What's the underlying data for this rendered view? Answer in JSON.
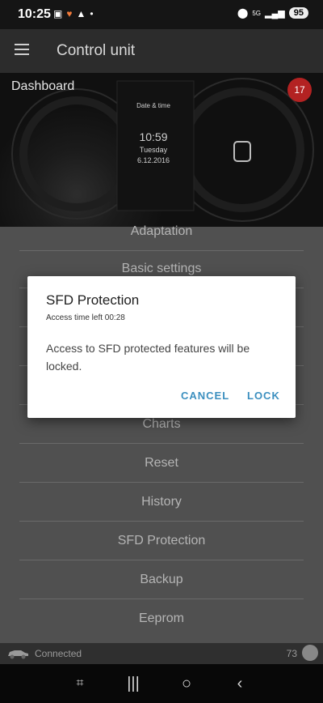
{
  "status_bar": {
    "time": "10:25",
    "battery": "95",
    "icons": [
      "screenshot-icon",
      "heart-icon",
      "vpn-icon",
      "dot-icon",
      "location-icon",
      "signal-5g-icon",
      "signal-bars-icon"
    ]
  },
  "app_bar": {
    "title": "Control unit"
  },
  "dashboard": {
    "title": "Dashboard",
    "badge": "17",
    "gauge_time": "10:59",
    "gauge_day": "Tuesday",
    "gauge_date": "6.12.2016",
    "gauge_label": "Date & time"
  },
  "menu": {
    "items": [
      "Adaptation",
      "Basic settings",
      "",
      "",
      "",
      "Charts",
      "Reset",
      "History",
      "SFD Protection",
      "Backup",
      "Eeprom"
    ]
  },
  "footer": {
    "status": "Connected",
    "count": "73"
  },
  "dialog": {
    "title": "SFD Protection",
    "subtitle": "Access time left 00:28",
    "message": "Access to SFD protected features will be locked.",
    "cancel": "CANCEL",
    "lock": "LOCK"
  },
  "colors": {
    "accent": "#3b8fbf",
    "badge": "#b32222"
  }
}
